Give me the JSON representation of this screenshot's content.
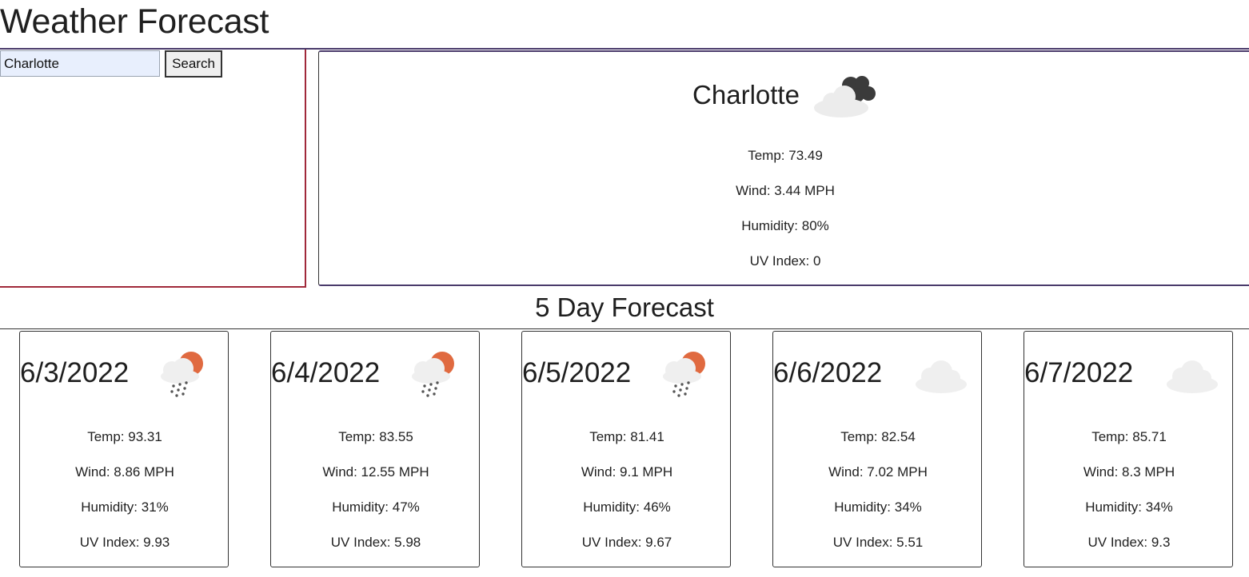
{
  "page": {
    "title": "Weather Forecast"
  },
  "search": {
    "value": "Charlotte",
    "button_label": "Search"
  },
  "current": {
    "city": "Charlotte",
    "icon": "cloudy-dark-icon",
    "temp": "Temp: 73.49",
    "wind": "Wind: 3.44 MPH",
    "humidity": "Humidity: 80%",
    "uv": "UV Index: 0"
  },
  "forecast": {
    "title": "5 Day Forecast",
    "days": [
      {
        "date": "6/3/2022",
        "icon": "rain-sun-icon",
        "temp": "Temp: 93.31",
        "wind": "Wind: 8.86 MPH",
        "humidity": "Humidity: 31%",
        "uv": "UV Index: 9.93"
      },
      {
        "date": "6/4/2022",
        "icon": "rain-sun-icon",
        "temp": "Temp: 83.55",
        "wind": "Wind: 12.55 MPH",
        "humidity": "Humidity: 47%",
        "uv": "UV Index: 5.98"
      },
      {
        "date": "6/5/2022",
        "icon": "rain-sun-icon",
        "temp": "Temp: 81.41",
        "wind": "Wind: 9.1 MPH",
        "humidity": "Humidity: 46%",
        "uv": "UV Index: 9.67"
      },
      {
        "date": "6/6/2022",
        "icon": "cloud-icon",
        "temp": "Temp: 82.54",
        "wind": "Wind: 7.02 MPH",
        "humidity": "Humidity: 34%",
        "uv": "UV Index: 5.51"
      },
      {
        "date": "6/7/2022",
        "icon": "cloud-icon",
        "temp": "Temp: 85.71",
        "wind": "Wind: 8.3 MPH",
        "humidity": "Humidity: 34%",
        "uv": "UV Index: 9.3"
      }
    ]
  },
  "colors": {
    "accent_rule": "#4a3b6b",
    "panel_border": "#a0293a",
    "sun": "#e06a40",
    "input_bg": "#e8effd"
  }
}
